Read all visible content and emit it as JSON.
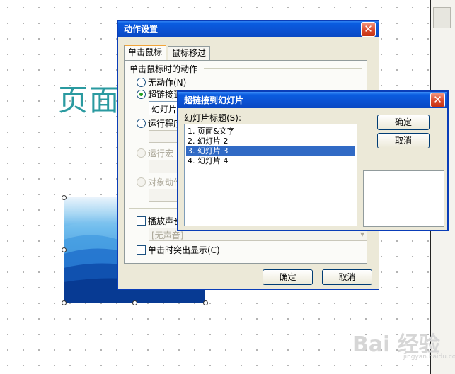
{
  "slide": {
    "title_visible": "页面",
    "picture": "blue mountains image"
  },
  "action_dialog": {
    "title": "动作设置",
    "tabs": [
      {
        "label": "单击鼠标",
        "active": true
      },
      {
        "label": "鼠标移过",
        "active": false
      }
    ],
    "group_label": "单击鼠标时的动作",
    "options": {
      "none": "无动作(N)",
      "hyperlink": "超链接到",
      "hyperlink_value": "幻灯片",
      "run_program": "运行程序",
      "run_macro": "运行宏",
      "object_action": "对象动作"
    },
    "play_sound": "播放声音",
    "sound_value": "[无声音]",
    "highlight_click": "单击时突出显示(C)",
    "ok": "确定",
    "cancel": "取消"
  },
  "hyperlink_dialog": {
    "title": "超链接到幻灯片",
    "list_label": "幻灯片标题(S):",
    "items": [
      "1. 页面&文字",
      "2. 幻灯片 2",
      "3. 幻灯片 3",
      "4. 幻灯片 4"
    ],
    "selected_index": 2,
    "ok": "确定",
    "cancel": "取消"
  },
  "colors": {
    "titlebar": "#0a52d6",
    "selection": "#316ac5",
    "slide_title": "#2a9aa0"
  },
  "watermark": {
    "text": "Bai 经验",
    "sub": "jingyan.baidu.com"
  }
}
